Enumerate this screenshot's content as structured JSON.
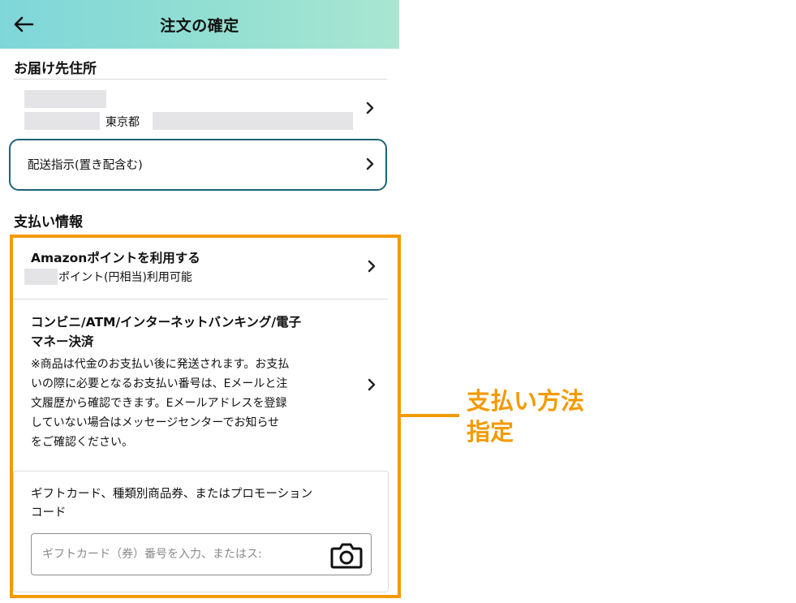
{
  "header": {
    "title": "注文の確定",
    "back_icon": "arrow-left-icon"
  },
  "address": {
    "section_title": "お届け先住所",
    "city": "東京都",
    "chevron_icon": "chevron-right-icon"
  },
  "delivery": {
    "label": "配送指示(置き配含む)",
    "chevron_icon": "chevron-right-icon"
  },
  "payment": {
    "section_title": "支払い情報",
    "points_title": "Amazonポイントを利用する",
    "points_sub": "ポイント(円相当)利用可能",
    "convenience_title_1": "コンビニ/ATM/インターネットバンキング/電子",
    "convenience_title_2": "マネー決済",
    "convenience_note_1": "※商品は代金のお支払い後に発送されます。お支払",
    "convenience_note_2": "いの際に必要となるお支払い番号は、Eメールと注",
    "convenience_note_3": "文履歴から確認できます。Eメールアドレスを登録",
    "convenience_note_4": "していない場合はメッセージセンターでお知らせ",
    "convenience_note_5": "をご確認ください。",
    "gift_label_1": "ギフトカード、種類別商品券、またはプロモーション",
    "gift_label_2": "コード",
    "gift_placeholder": "ギフトカード（券）番号を入力、またはス:",
    "gift_value": "",
    "camera_icon": "camera-icon"
  },
  "annotation": {
    "line1": "支払い方法",
    "line2": "指定",
    "color": "#f39a00"
  },
  "colors": {
    "header_start": "#7fd6d9",
    "header_end": "#a9e6d1",
    "delivery_border": "#1e6374",
    "annotation": "#f39a00"
  }
}
